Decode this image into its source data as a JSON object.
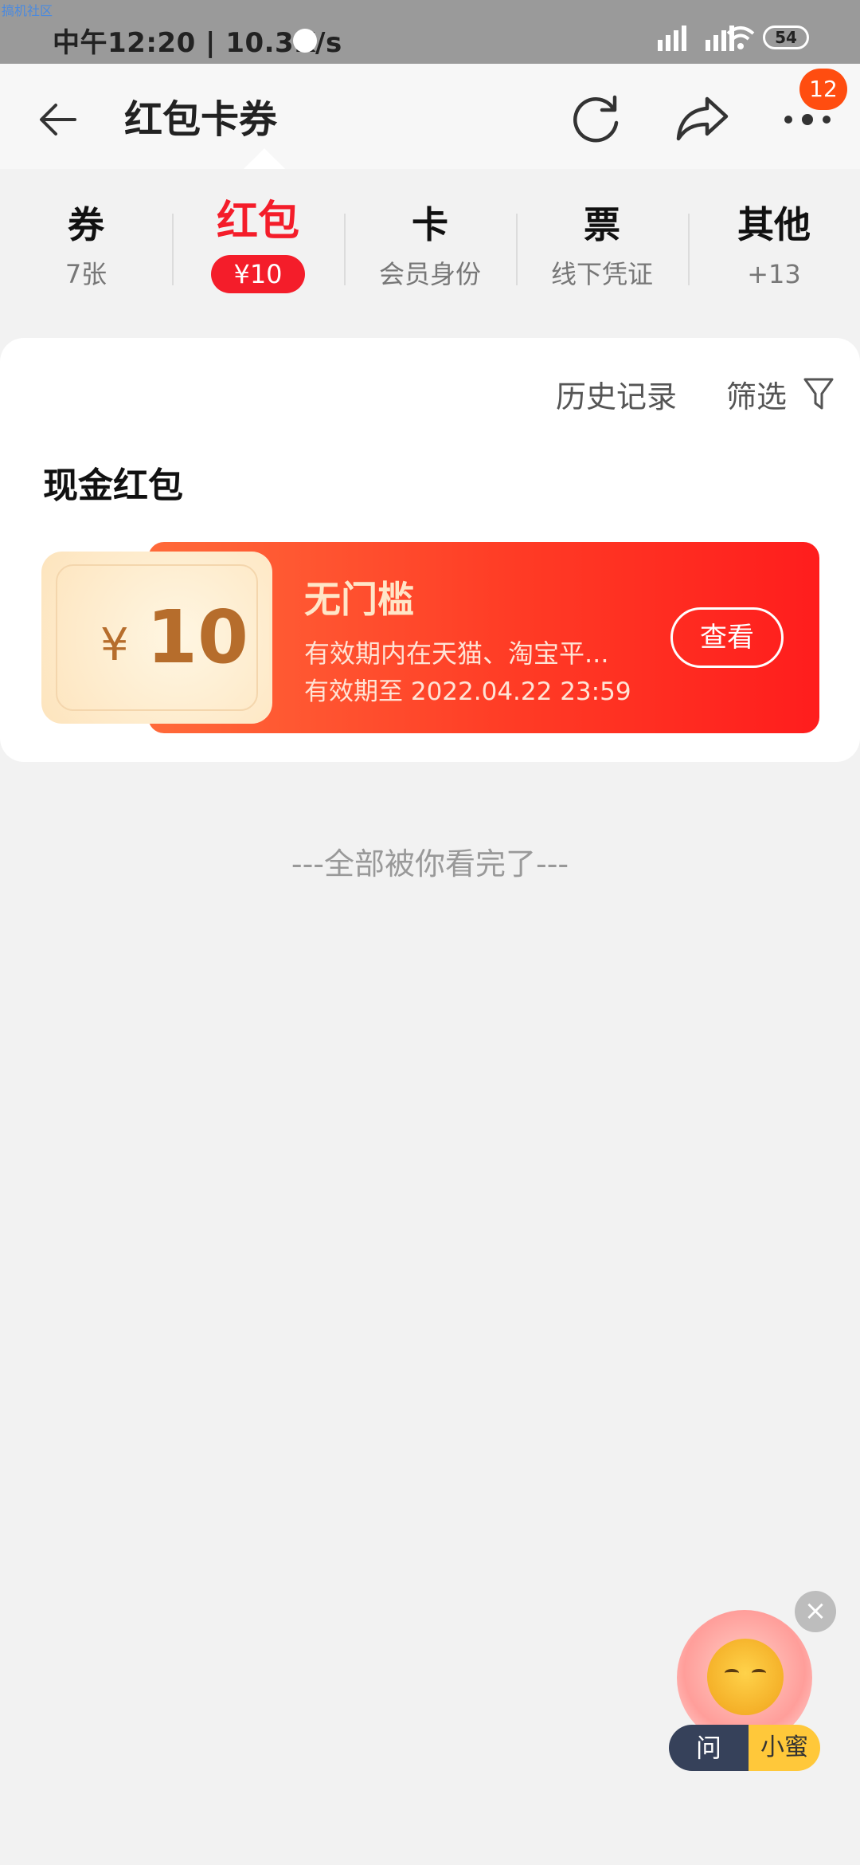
{
  "status_bar": {
    "watermark": "搞机社区",
    "time": "中午12:20 | 10.3K/s",
    "battery": "54"
  },
  "header": {
    "title": "红包卡券",
    "badge_count": "12"
  },
  "tabs": [
    {
      "title": "券",
      "sub": "7张"
    },
    {
      "title": "红包",
      "sub": "¥10",
      "active": true
    },
    {
      "title": "卡",
      "sub": "会员身份"
    },
    {
      "title": "票",
      "sub": "线下凭证"
    },
    {
      "title": "其他",
      "sub": "+13"
    }
  ],
  "toolbar": {
    "history": "历史记录",
    "filter": "筛选"
  },
  "section": {
    "title": "现金红包"
  },
  "packet": {
    "currency": "¥",
    "amount": "10",
    "name": "无门槛",
    "desc": "有效期内在天猫、淘宝平...",
    "expiry": "有效期至 2022.04.22 23:59",
    "action": "查看"
  },
  "end_text": "---全部被你看完了---",
  "assistant": {
    "ask": "问",
    "name": "小蜜"
  },
  "colors": {
    "accent": "#f41d2a",
    "badge": "#ff4d10",
    "packet_gold": "#b66d2c"
  }
}
